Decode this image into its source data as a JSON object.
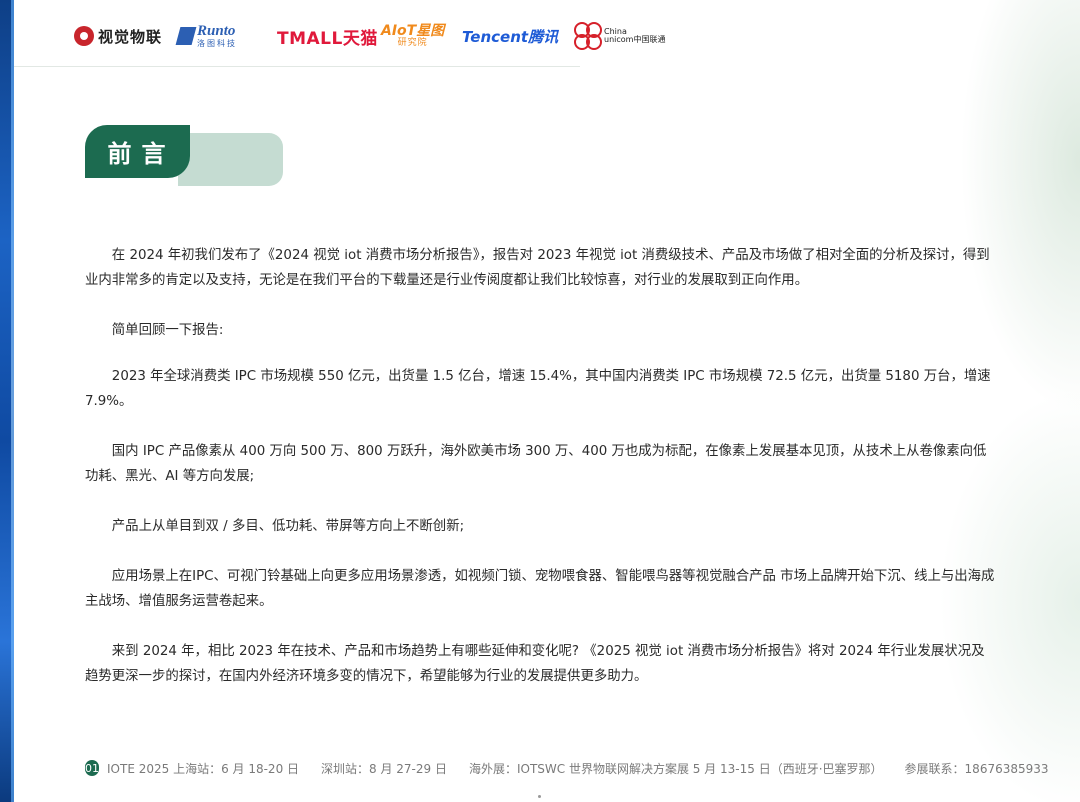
{
  "logos": {
    "shijue": "视觉物联",
    "runto_en": "Runto",
    "runto_cn": "洛图科技",
    "tmall": "TMALL天猫",
    "aiot_top": "AIoT星图",
    "aiot_bottom": "研究院",
    "tencent": "Tencent腾讯",
    "unicom_top": "China",
    "unicom_bottom": "unicom中国联通"
  },
  "section": {
    "title": "前言"
  },
  "paragraphs": [
    "在 2024 年初我们发布了《2024 视觉 iot 消费市场分析报告》，报告对 2023 年视觉 iot 消费级技术、产品及市场做了相对全面的分析及探讨，得到业内非常多的肯定以及支持，无论是在我们平台的下载量还是行业传阅度都让我们比较惊喜，对行业的发展取到正向作用。",
    "简单回顾一下报告:",
    "2023 年全球消费类 IPC 市场规模 550 亿元，出货量 1.5 亿台，增速 15.4%，其中国内消费类 IPC 市场规模 72.5 亿元，出货量 5180 万台，增速 7.9%。",
    "国内 IPC 产品像素从 400 万向 500 万、800 万跃升，海外欧美市场 300 万、400 万也成为标配，在像素上发展基本见顶，从技术上从卷像素向低功耗、黑光、AI 等方向发展;",
    "产品上从单目到双 / 多目、低功耗、带屏等方向上不断创新;",
    "应用场景上在IPC、可视门铃基础上向更多应用场景渗透，如视频门锁、宠物喂食器、智能喂鸟器等视觉融合产品  市场上品牌开始下沉、线上与出海成主战场、增值服务运营卷起来。",
    "来到 2024 年，相比 2023 年在技术、产品和市场趋势上有哪些延伸和变化呢? 《2025 视觉 iot 消费市场分析报告》将对 2024 年行业发展状况及趋势更深一步的探讨，在国内外经济环境多变的情况下，希望能够为行业的发展提供更多助力。"
  ],
  "footer": {
    "page_number": "01",
    "shanghai": "IOTE 2025 上海站：6 月 18-20 日",
    "shenzhen": "深圳站：8 月 27-29 日",
    "overseas": "海外展：IOTSWC 世界物联网解决方案展 5 月 13-15 日（西班牙·巴塞罗那）",
    "contact": "参展联系：18676385933"
  },
  "colors": {
    "accent_green": "#1c6b50",
    "light_green": "#c5dcd2",
    "left_strip_blue": "#1c63c4"
  }
}
